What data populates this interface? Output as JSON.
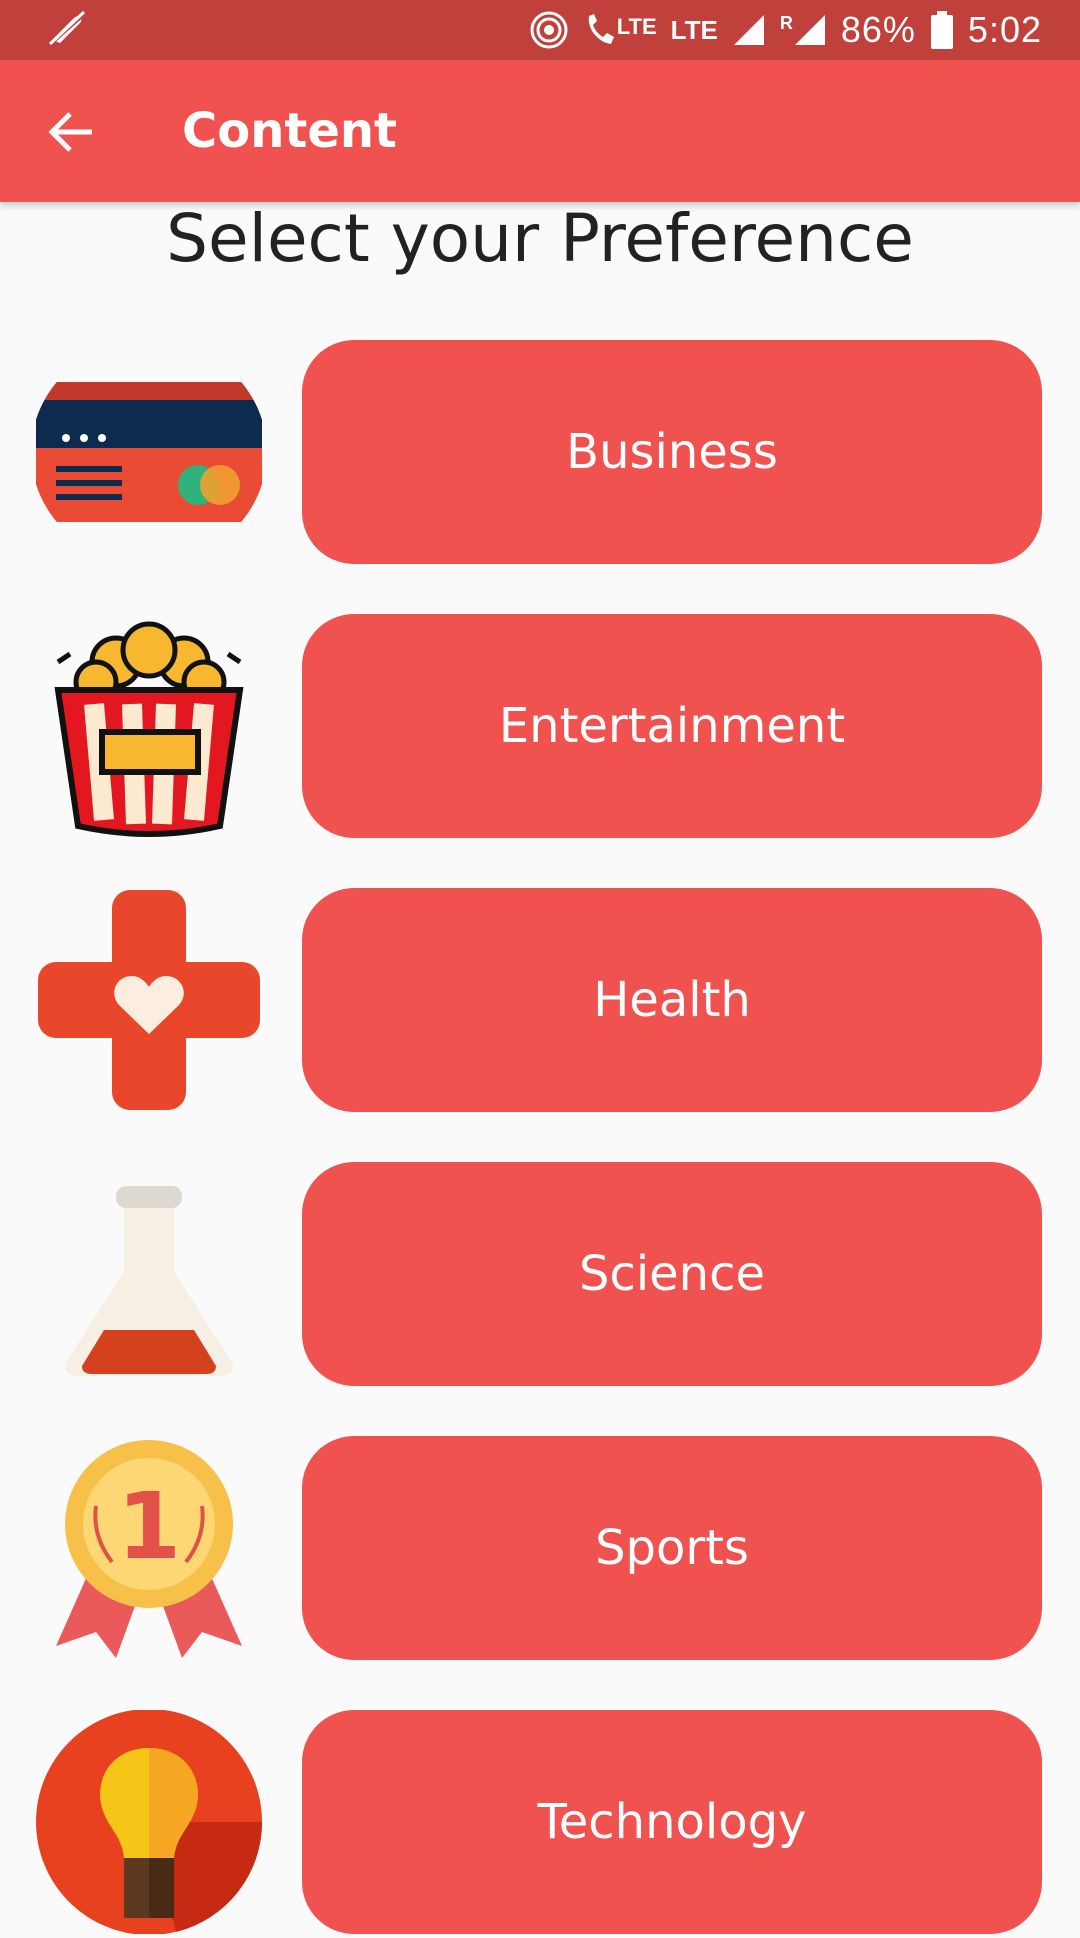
{
  "status_bar": {
    "lte_small": "LTE",
    "lte": "LTE",
    "roaming": "R",
    "battery": "86%",
    "time": "5:02"
  },
  "app_bar": {
    "title": "Content"
  },
  "heading": "Select your Preference",
  "preferences": [
    {
      "label": "Business",
      "icon": "credit-card-icon"
    },
    {
      "label": "Entertainment",
      "icon": "popcorn-icon"
    },
    {
      "label": "Health",
      "icon": "medical-cross-heart-icon"
    },
    {
      "label": "Science",
      "icon": "flask-icon"
    },
    {
      "label": "Sports",
      "icon": "medal-icon"
    },
    {
      "label": "Technology",
      "icon": "lightbulb-icon"
    }
  ],
  "colors": {
    "status_bar": "#c0403c",
    "primary": "#f0524f",
    "background": "#fafafa"
  }
}
